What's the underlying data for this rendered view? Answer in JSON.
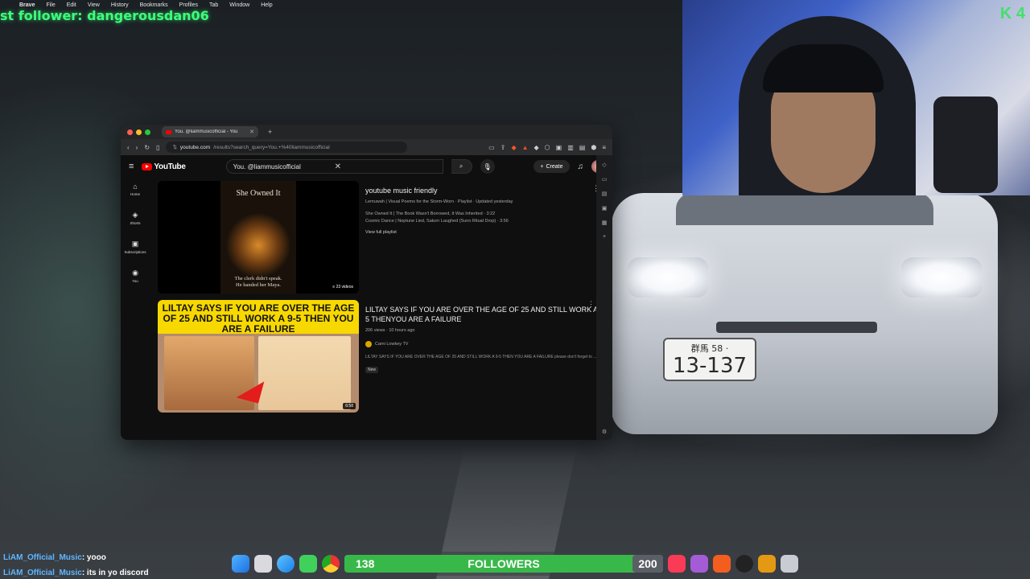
{
  "system": {
    "menubar": [
      "Brave",
      "File",
      "Edit",
      "View",
      "History",
      "Bookmarks",
      "Profiles",
      "Tab",
      "Window",
      "Help"
    ],
    "follower_alert": "st follower: dangerousdan06",
    "cam_logo": "K 4"
  },
  "browser": {
    "tab_title": "You. @liammusicofficial - You",
    "url_host": "youtube.com",
    "url_path": "/results?search_query=You.+%40liammusicofficial"
  },
  "youtube": {
    "logo": "YouTube",
    "search_value": "You. @liammusicofficial",
    "create_label": "Create",
    "sidebar": [
      {
        "label": "Home",
        "icon": "⌂"
      },
      {
        "label": "Shorts",
        "icon": "◈"
      },
      {
        "label": "Subscriptions",
        "icon": "▣"
      },
      {
        "label": "You",
        "icon": "◉"
      }
    ],
    "results": [
      {
        "thumb_title": "She Owned It",
        "thumb_caption_1": "The clerk didn't speak.",
        "thumb_caption_2": "He handed her Maya.",
        "badge": "≡ 23 videos",
        "title": "youtube music friendly",
        "sub": "Lemuwah | Visual Poems for the Storm-Worn · Playlist · Updated yesterday",
        "line1": "She Owned It | The Book Wasn't Borrowed, It Was Inherited · 3:22",
        "line2": "Cosmic Dance | Neptune Lied, Saturn Laughed (Suno Ritual Drop) · 3:56",
        "link": "View full playlist"
      },
      {
        "thumb_headline": "LILTAY SAYS IF YOU ARE OVER THE AGE OF 25 AND STILL WORK A 9-5 THEN YOU ARE A FAILURE",
        "badge": "6:58",
        "title": "LILTAY SAYS IF YOU ARE OVER THE AGE OF 25 AND STILL WORK A 9-5 THENYOU ARE A FAILURE",
        "stats": "206 views · 10 hours ago",
        "channel": "Cami Lowkey TV",
        "desc": "LILTAY SAYS IF YOU ARE OVER THE AGE OF 25 AND STILL WORK A 9-5 THEN YOU ARE A FAILURE please don't forget to ...",
        "new_badge": "New"
      }
    ]
  },
  "plate": {
    "top": "群馬 58 ·",
    "number": "13-137"
  },
  "chat": [
    {
      "user": "LiAM_Official_Music",
      "msg": ": yooo"
    },
    {
      "user": "LiAM_Official_Music",
      "msg": ": its in yo discord"
    }
  ],
  "follower_goal": {
    "count": "138",
    "label": "FOLLOWERS",
    "goal": "200"
  },
  "colors": {
    "accent_green": "#39b84a",
    "youtube_red": "#ff0000",
    "alert_green": "#3cff7a"
  }
}
